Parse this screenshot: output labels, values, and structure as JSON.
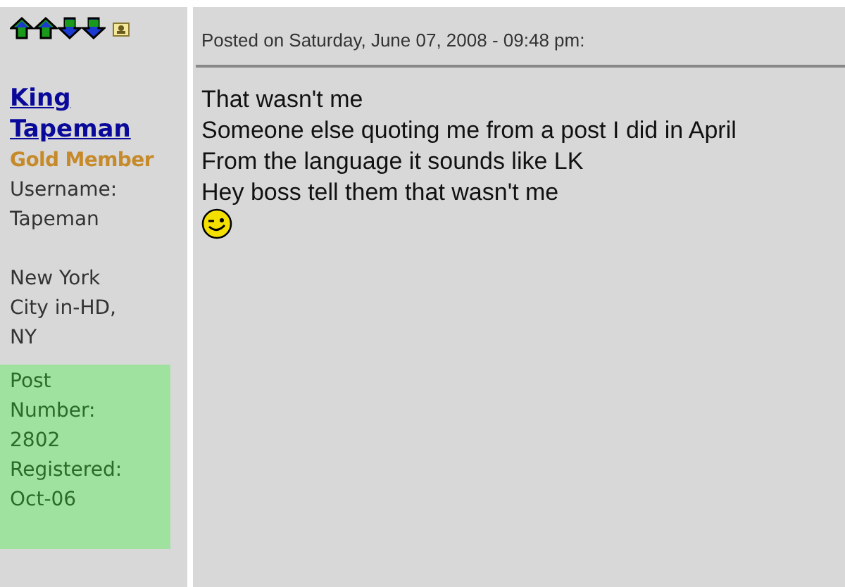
{
  "author": {
    "name": "King Tapeman",
    "rank": "Gold Member",
    "username_label": "Username:",
    "username": "Tapeman",
    "location": "New York City in-HD, NY"
  },
  "stats": {
    "post_number_label": "Post Number:",
    "post_number": "2802",
    "registered_label": "Registered:",
    "registered": "Oct-06"
  },
  "post": {
    "header": "Posted on Saturday, June 07, 2008 - 09:48 pm:",
    "body": [
      {
        "kind": "text",
        "text": "That wasn't me"
      },
      {
        "kind": "text",
        "text": "Someone else quoting me from a post I did in April"
      },
      {
        "kind": "text",
        "text": "From the language it sounds like LK"
      },
      {
        "kind": "text",
        "text": "Hey boss tell them that wasn't me"
      },
      {
        "kind": "wink"
      }
    ]
  }
}
